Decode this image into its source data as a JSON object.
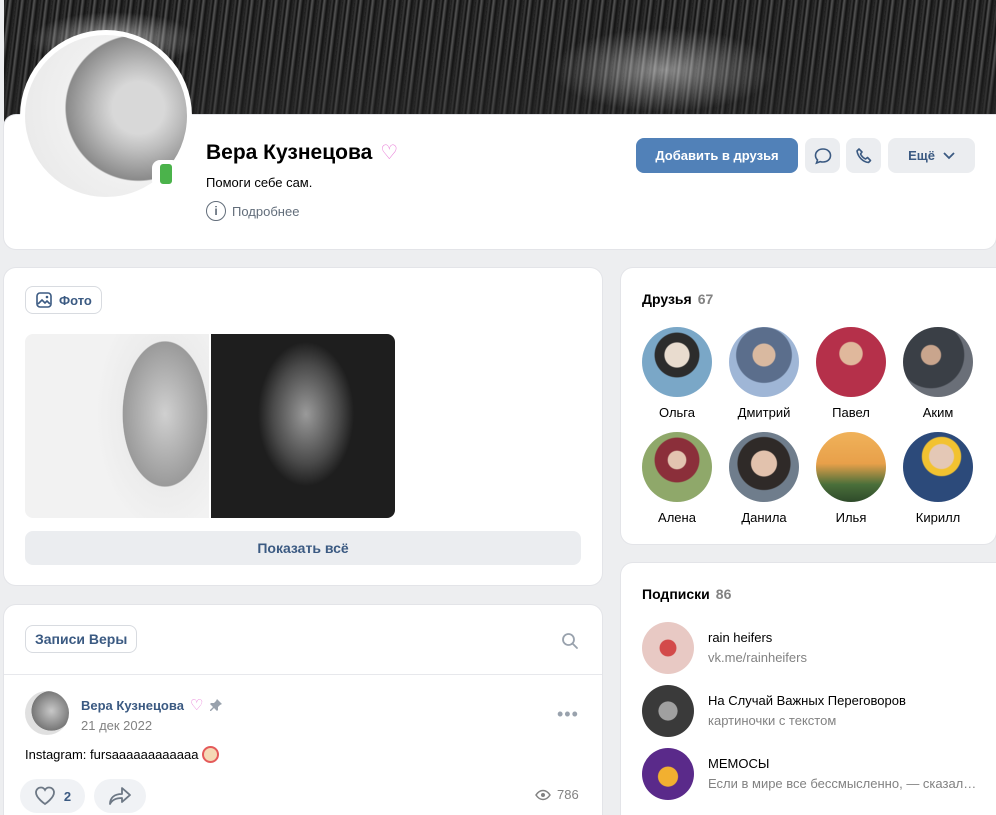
{
  "profile": {
    "name": "Вера Кузнецова",
    "status": "Помоги себе сам.",
    "more_info": "Подробнее",
    "add_friend": "Добавить в друзья",
    "more": "Ещё"
  },
  "photos": {
    "tab_label": "Фото",
    "show_all": "Показать всё"
  },
  "posts": {
    "tab_label": "Записи Веры",
    "post": {
      "author": "Вера Кузнецова",
      "date": "21 дек 2022",
      "text": "Instagram: fursaaaaaaaaaaaa",
      "likes": "2",
      "views": "786"
    }
  },
  "friends": {
    "title": "Друзья",
    "count": "67",
    "items": [
      {
        "name": "Ольга",
        "color": "#7aa7c7"
      },
      {
        "name": "Дмитрий",
        "color": "#5b6e8c"
      },
      {
        "name": "Павел",
        "color": "#b5304a"
      },
      {
        "name": "Аким",
        "color": "#3a3f46"
      },
      {
        "name": "Алена",
        "color": "#8fa86a"
      },
      {
        "name": "Данила",
        "color": "#6f7d8c"
      },
      {
        "name": "Илья",
        "color": "#e8a04a"
      },
      {
        "name": "Кирилл",
        "color": "#2c4a7a"
      }
    ]
  },
  "subscriptions": {
    "title": "Подписки",
    "count": "86",
    "items": [
      {
        "title": "rain heifers",
        "subtitle": "vk.me/rainheifers",
        "color": "#e8c9c4"
      },
      {
        "title": "На Случай Важных Переговоров",
        "subtitle": "картиночки с текстом",
        "color": "#3a3a3a"
      },
      {
        "title": "МЕМОСЫ",
        "subtitle": "Если в мире все бессмысленно, — сказала Алиса",
        "color": "#5a2a8a"
      }
    ]
  }
}
